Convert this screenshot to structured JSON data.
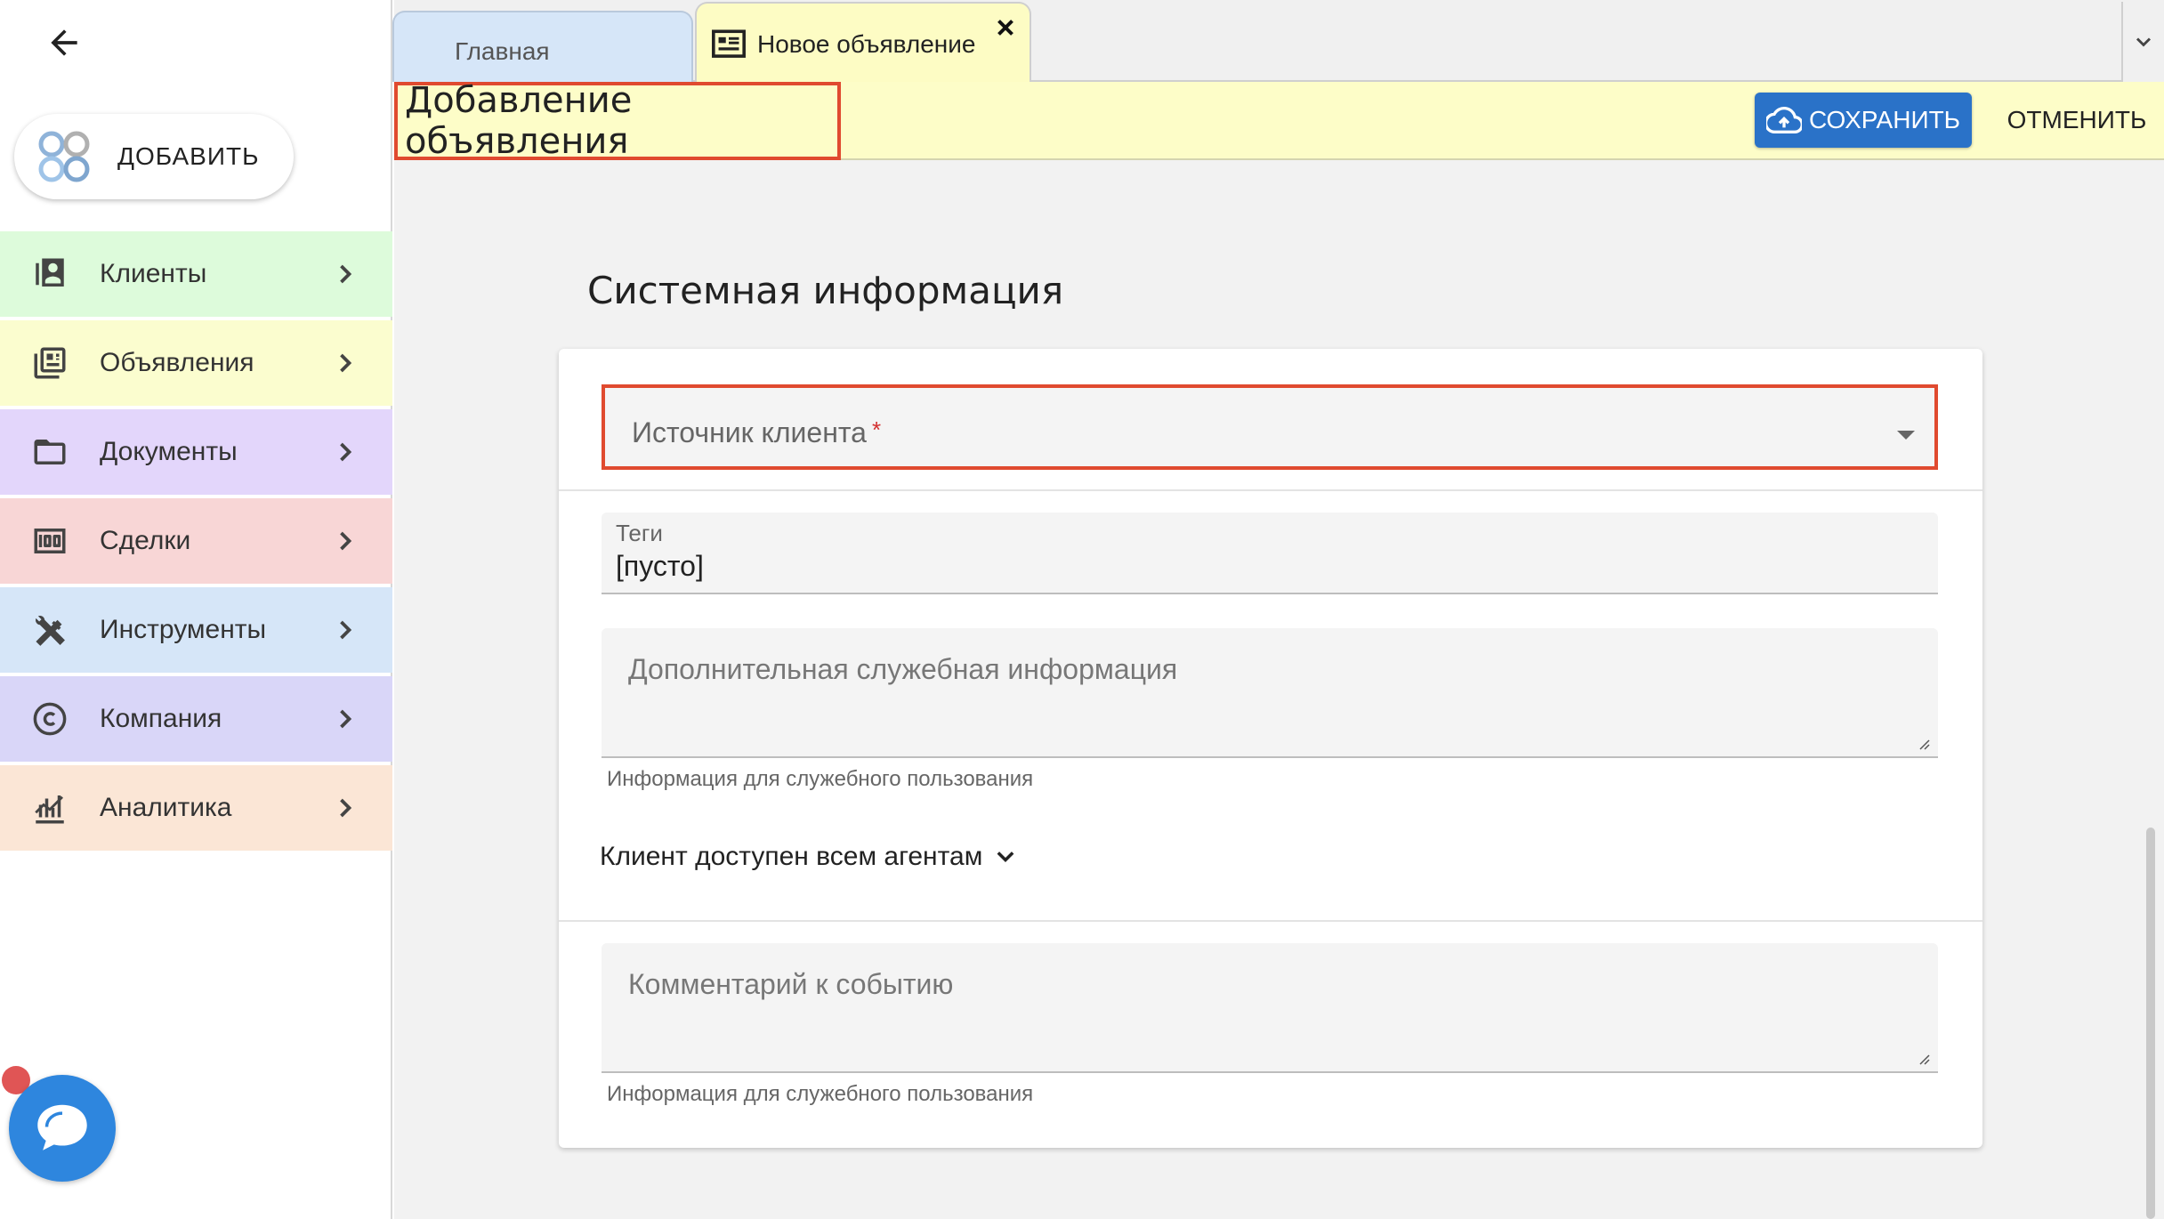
{
  "sidebar": {
    "add_label": "ДОБАВИТЬ",
    "items": [
      {
        "label": "Клиенты",
        "icon": "client-card-icon",
        "bg": "#ddfbdb"
      },
      {
        "label": "Объявления",
        "icon": "listing-icon",
        "bg": "#fbfdcf"
      },
      {
        "label": "Документы",
        "icon": "folder-icon",
        "bg": "#e3d6fb"
      },
      {
        "label": "Сделки",
        "icon": "money-icon",
        "bg": "#f8d6d6"
      },
      {
        "label": "Инструменты",
        "icon": "tools-icon",
        "bg": "#d6e6f8"
      },
      {
        "label": "Компания",
        "icon": "copyright-icon",
        "bg": "#d9d6f8"
      },
      {
        "label": "Аналитика",
        "icon": "analytics-icon",
        "bg": "#fbe6d6"
      }
    ]
  },
  "tabs": {
    "home": "Главная",
    "new_listing": "Новое объявление"
  },
  "header": {
    "title": "Добавление объявления",
    "save_label": "СОХРАНИТЬ",
    "cancel_label": "ОТМЕНИТЬ"
  },
  "form": {
    "section_title": "Системная информация",
    "client_source_label": "Источник клиента",
    "required_mark": "*",
    "tags_label": "Теги",
    "tags_value": "[пусто]",
    "extra_info_placeholder": "Дополнительная служебная информация",
    "extra_info_hint": "Информация для служебного пользования",
    "agents_toggle": "Клиент доступен всем агентам",
    "comment_placeholder": "Комментарий к событию",
    "comment_hint": "Информация для служебного пользования"
  },
  "colors": {
    "accent": "#2a72c8",
    "highlight": "#e04a2f",
    "header_bg": "#fdfdc8"
  }
}
